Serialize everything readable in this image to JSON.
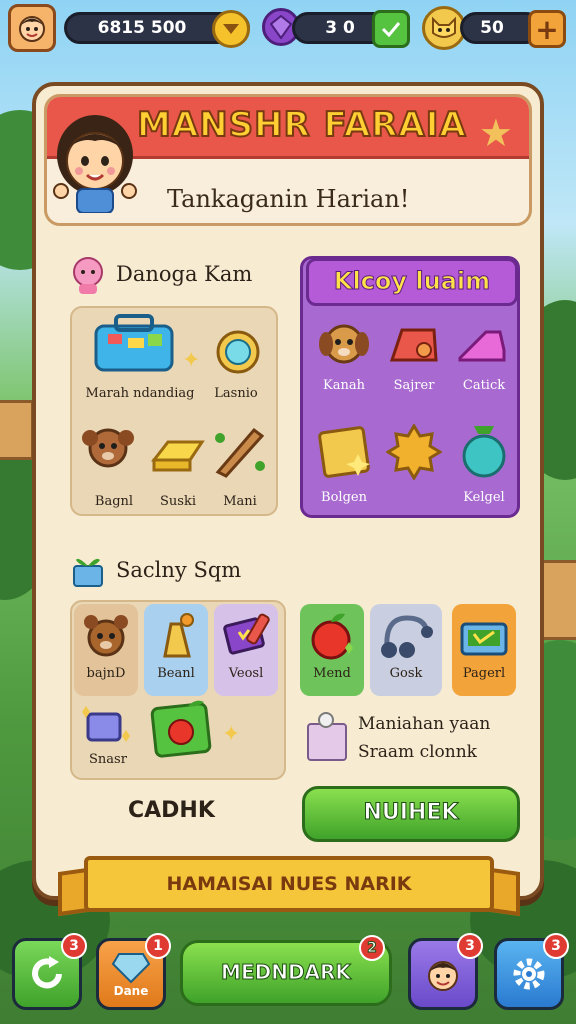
{
  "topbar": {
    "coins_value": "6815 500",
    "gems_value": "3 0",
    "stars_value": "50",
    "coin_icon": "chevron-down-coin-icon",
    "gem_icon": "purple-gem-icon",
    "add_icon": "plus-icon"
  },
  "header": {
    "title": "MANSHR FARAIA",
    "subtitle": "Tankaganin Harian!"
  },
  "section1": {
    "title": "Danoga Kam",
    "items": [
      "Marah ndandiag",
      "Lasnio",
      "Bagnl",
      "Suski",
      "Mani"
    ]
  },
  "section2": {
    "title": "Klcoy luaim",
    "items": [
      "Kanah",
      "Sajrer",
      "Catick",
      "Bolgen",
      "Kelgel"
    ]
  },
  "section3": {
    "title": "Saclny Sqm",
    "tiles": [
      "bajnD",
      "Beanl",
      "Veosl",
      "Mend",
      "Gosk",
      "Pagerl",
      "Snasr"
    ],
    "note_line1": "Maniahan yaan",
    "note_line2": "Sraam clonnk"
  },
  "buttons": {
    "left_label": "CADHK",
    "right_label": "NUIHEK"
  },
  "ribbon": {
    "label": "HAMAISAI NUES NARIK"
  },
  "bottom_nav": {
    "home_badge": "3",
    "bag_label": "Dane",
    "bag_badge": "1",
    "main_label": "MEDNDARK",
    "main_badge": "2",
    "friend_badge": "3",
    "settings_badge": "3"
  },
  "colors": {
    "accent_red": "#e8574a",
    "accent_purple": "#b65bd8",
    "accent_green": "#3fa22a",
    "gold": "#f5c63a"
  }
}
